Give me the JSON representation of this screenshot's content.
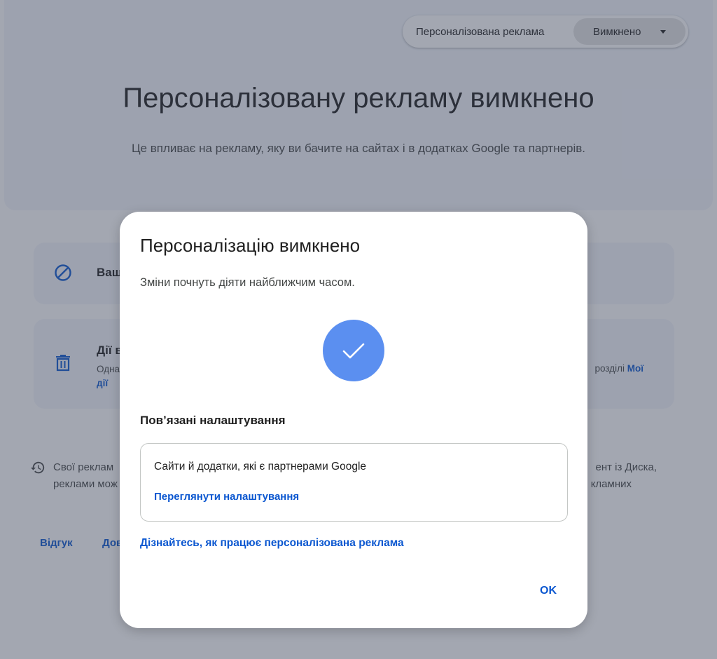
{
  "header": {
    "toggle_label": "Персоналізована реклама",
    "toggle_value": "Вимкнено"
  },
  "hero": {
    "title": "Персоналізовану рекламу вимкнено",
    "subtitle": "Це впливає на рекламу, яку ви бачите на сайтах і в додатках Google та партнерів."
  },
  "cards": [
    {
      "icon": "block-icon",
      "title": "Ваш"
    },
    {
      "icon": "trash-icon",
      "title": "Дії в",
      "desc_left": "Одна",
      "desc_right_text": "розділі ",
      "desc_right_link": "Мої",
      "link_continued": "дії"
    }
  ],
  "history": {
    "icon": "history-icon",
    "line1_left": "Свої реклам",
    "line2_left": "реклами мож",
    "line1_right": "ент із Диска,",
    "line2_right": "кламних"
  },
  "footer": {
    "links": [
      "Відгук",
      "Дов"
    ]
  },
  "dialog": {
    "title": "Персоналізацію вимкнено",
    "subtitle": "Зміни почнуть діяти найближчим часом.",
    "check_icon": "check-icon",
    "related_heading": "Пов’язані налаштування",
    "related_card": {
      "title": "Сайти й додатки, які є партнерами Google",
      "link": "Переглянути налаштування"
    },
    "learn_link": "Дізнайтесь, як працює персоналізована реклама",
    "ok_label": "OK"
  },
  "colors": {
    "accent": "#0b57d0",
    "check_circle": "#5b8ff0",
    "scrim": "rgba(60,68,90,0.47)",
    "surface": "#f3f6fc"
  }
}
